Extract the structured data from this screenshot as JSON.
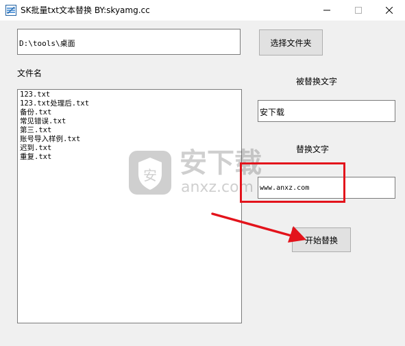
{
  "window": {
    "title": "SK批量txt文本替换 BY:skyamg.cc",
    "minimize_glyph": "—",
    "maximize_glyph": "☐",
    "close_glyph": "✕",
    "icon": "app-icon"
  },
  "path": {
    "value": "D:\\tools\\桌面"
  },
  "buttons": {
    "select_folder": "选择文件夹",
    "start": "开始替换"
  },
  "labels": {
    "filename": "文件名",
    "find_text": "被替换文字",
    "replace_text": "替换文字"
  },
  "files": [
    "123.txt",
    "123.txt处理后.txt",
    "备份.txt",
    "常见错误.txt",
    "第三.txt",
    "账号导入样例.txt",
    "迟到.txt",
    "重复.txt"
  ],
  "find_field": {
    "value": "安下载"
  },
  "replace_field": {
    "value": "www.anxz.com"
  },
  "watermark": {
    "brand": "安下载",
    "domain": "anxz.com",
    "icon": "shield-icon",
    "badge": "安"
  },
  "annotation": {
    "highlight_color": "#e3131b",
    "arrow_color": "#e3131b"
  }
}
